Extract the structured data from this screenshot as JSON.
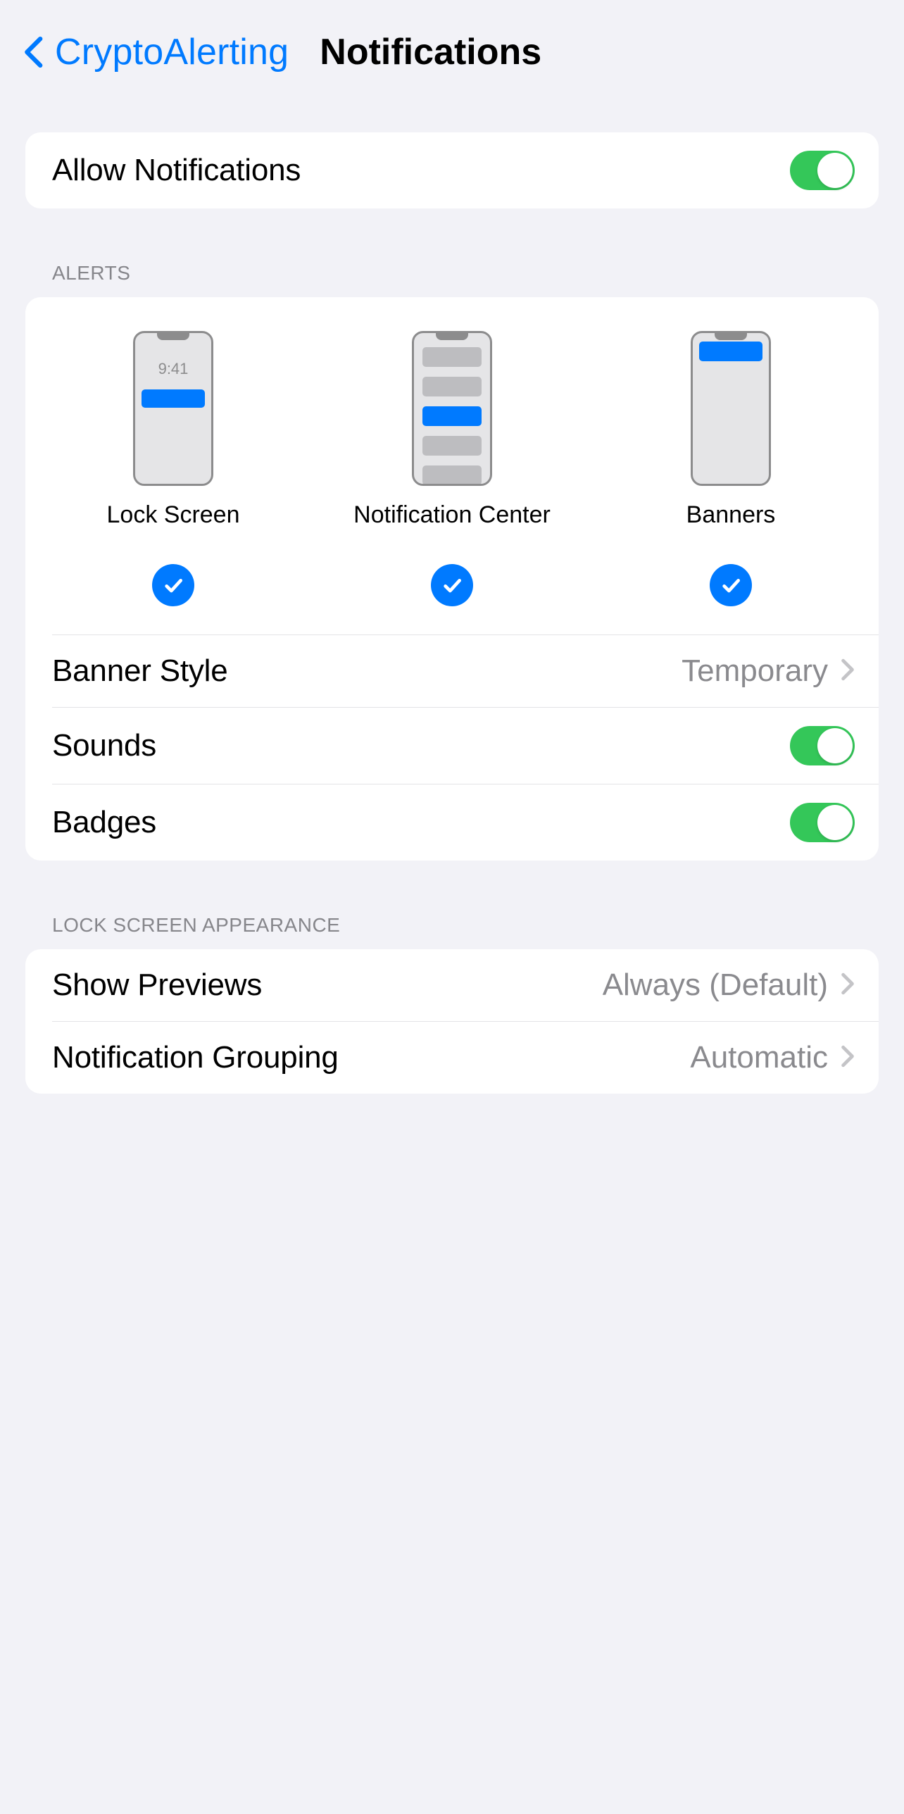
{
  "nav": {
    "back_label": "CryptoAlerting",
    "title": "Notifications"
  },
  "allow": {
    "label": "Allow Notifications",
    "on": true
  },
  "alerts": {
    "header": "ALERTS",
    "options": {
      "lock_screen": {
        "label": "Lock Screen",
        "time": "9:41",
        "checked": true
      },
      "notification_center": {
        "label": "Notification Center",
        "checked": true
      },
      "banners": {
        "label": "Banners",
        "checked": true
      }
    },
    "banner_style": {
      "label": "Banner Style",
      "value": "Temporary"
    },
    "sounds": {
      "label": "Sounds",
      "on": true
    },
    "badges": {
      "label": "Badges",
      "on": true
    }
  },
  "lock_screen_appearance": {
    "header": "LOCK SCREEN APPEARANCE",
    "show_previews": {
      "label": "Show Previews",
      "value": "Always (Default)"
    },
    "notification_grouping": {
      "label": "Notification Grouping",
      "value": "Automatic"
    }
  }
}
